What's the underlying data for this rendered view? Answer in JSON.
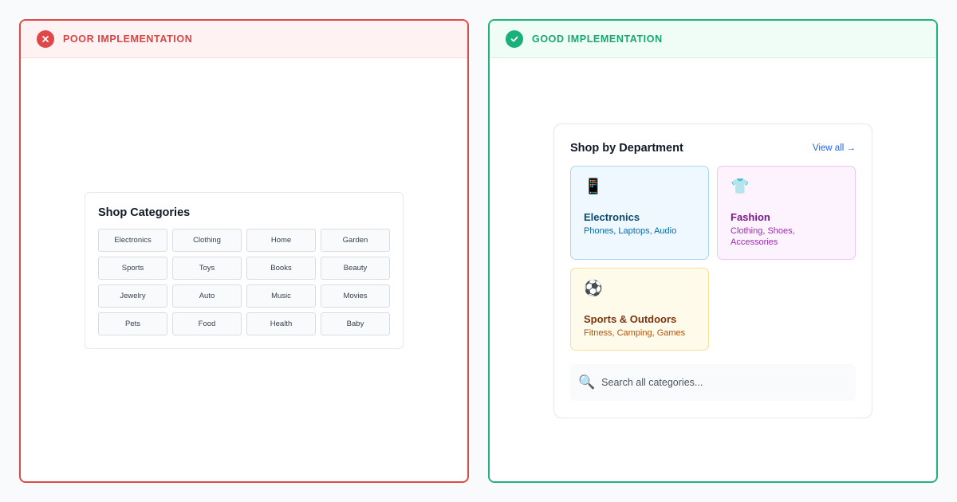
{
  "poor": {
    "label": "POOR IMPLEMENTATION",
    "card_title": "Shop Categories",
    "categories": [
      "Electronics",
      "Clothing",
      "Home",
      "Garden",
      "Sports",
      "Toys",
      "Books",
      "Beauty",
      "Jewelry",
      "Auto",
      "Music",
      "Movies",
      "Pets",
      "Food",
      "Health",
      "Baby"
    ]
  },
  "good": {
    "label": "GOOD IMPLEMENTATION",
    "card_title": "Shop by Department",
    "view_all": "View all →",
    "departments": [
      {
        "icon": "📱",
        "icon_name": "phone-icon",
        "name": "Electronics",
        "sub": "Phones, Laptops, Audio"
      },
      {
        "icon": "👕",
        "icon_name": "shirt-icon",
        "name": "Fashion",
        "sub": "Clothing, Shoes, Accessories"
      },
      {
        "icon": "⚽",
        "icon_name": "soccer-ball-icon",
        "name": "Sports & Outdoors",
        "sub": "Fitness, Camping, Games"
      }
    ],
    "search_placeholder": "Search all categories..."
  },
  "colors": {
    "poor_accent": "#dc4a4a",
    "good_accent": "#22b07d",
    "link": "#2563eb"
  }
}
